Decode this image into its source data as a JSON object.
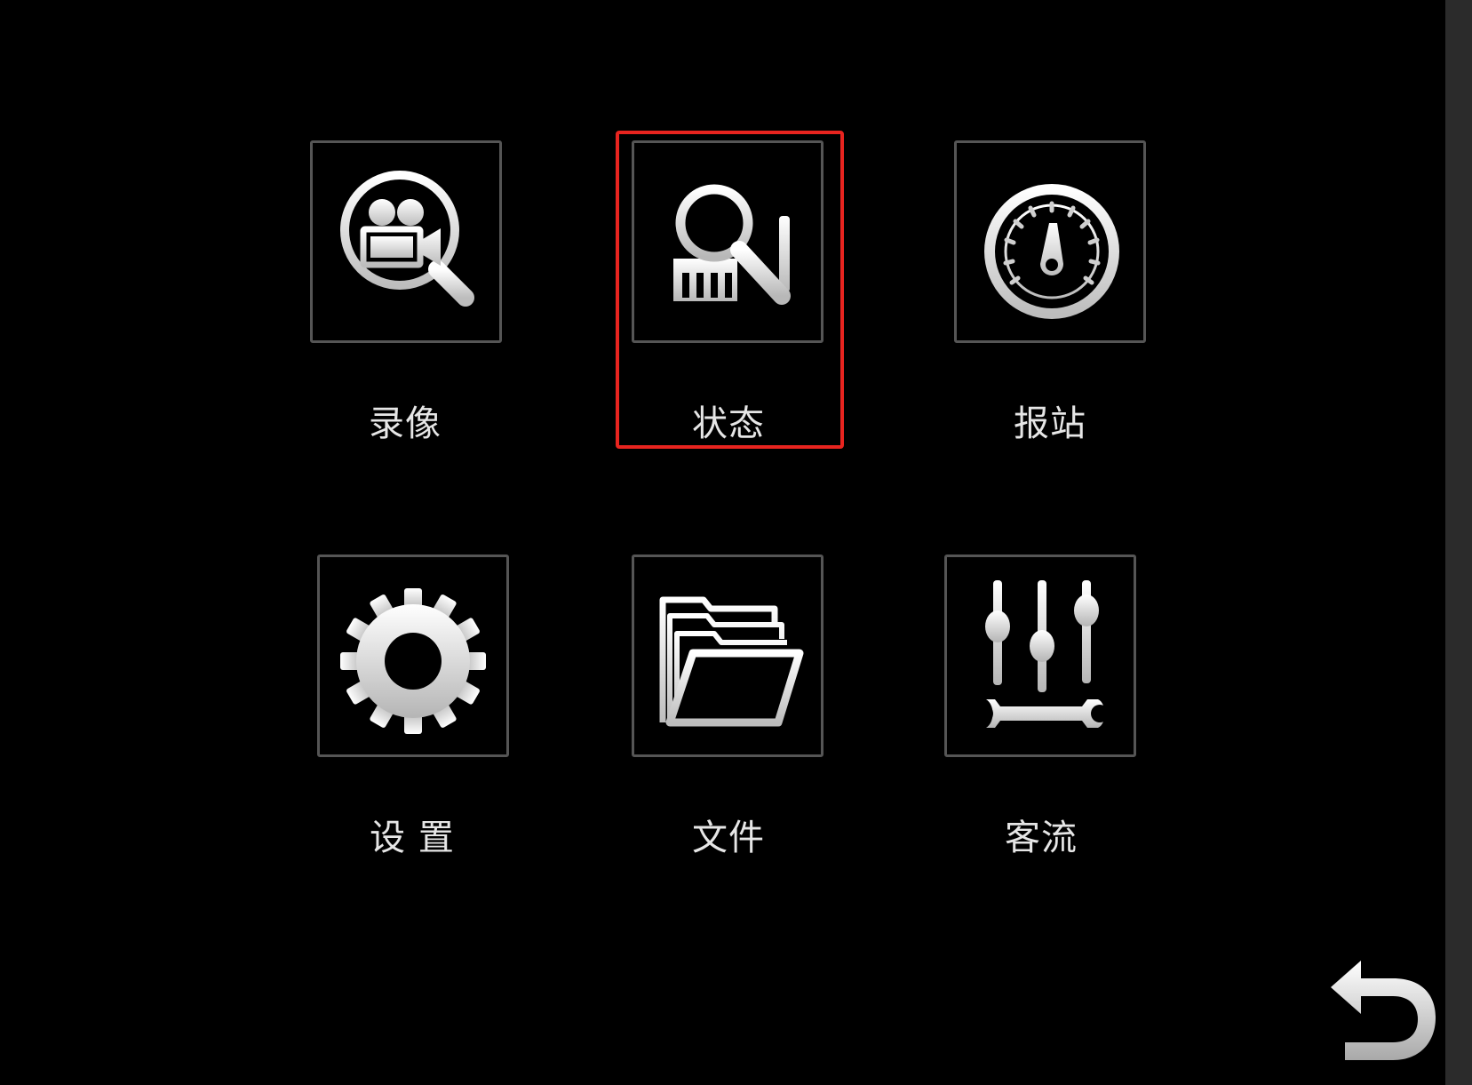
{
  "menu": {
    "tiles": [
      {
        "label": "录像",
        "icon": "video-search-icon"
      },
      {
        "label": "状态",
        "icon": "status-search-icon"
      },
      {
        "label": "报站",
        "icon": "speedometer-icon"
      },
      {
        "label": "设 置",
        "icon": "gear-icon"
      },
      {
        "label": "文件",
        "icon": "folder-icon"
      },
      {
        "label": "客流",
        "icon": "equalizer-wrench-icon"
      }
    ],
    "selected": "状态"
  },
  "back_button": {
    "icon": "back-arrow-icon"
  },
  "colors": {
    "background": "#000000",
    "tile_border": "#555555",
    "label_text": "#e6e6e6",
    "selection_highlight": "#e8241f"
  }
}
